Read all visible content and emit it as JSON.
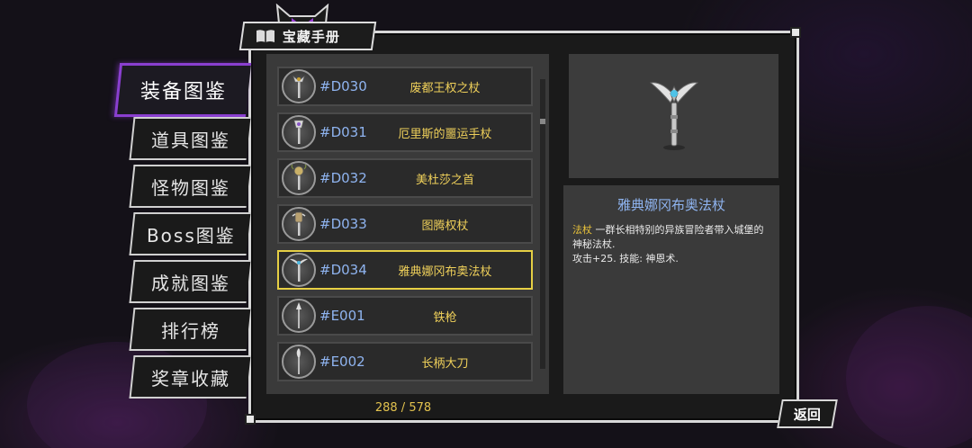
{
  "title": "宝藏手册",
  "categories": [
    {
      "label": "装备图鉴",
      "active": true
    },
    {
      "label": "道具图鉴",
      "active": false
    },
    {
      "label": "怪物图鉴",
      "active": false
    },
    {
      "label": "Boss图鉴",
      "active": false
    },
    {
      "label": "成就图鉴",
      "active": false
    },
    {
      "label": "排行榜",
      "active": false
    },
    {
      "label": "奖章收藏",
      "active": false
    }
  ],
  "items": [
    {
      "code": "#D030",
      "name": "废都王权之杖",
      "icon": "scepter-icon",
      "selected": false
    },
    {
      "code": "#D031",
      "name": "厄里斯的噩运手杖",
      "icon": "staff-icon",
      "selected": false
    },
    {
      "code": "#D032",
      "name": "美杜莎之首",
      "icon": "medusa-staff-icon",
      "selected": false
    },
    {
      "code": "#D033",
      "name": "图腾权杖",
      "icon": "totem-staff-icon",
      "selected": false
    },
    {
      "code": "#D034",
      "name": "雅典娜冈布奥法杖",
      "icon": "winged-staff-icon",
      "selected": true
    },
    {
      "code": "#E001",
      "name": "铁枪",
      "icon": "spear-icon",
      "selected": false
    },
    {
      "code": "#E002",
      "name": "长柄大刀",
      "icon": "glaive-icon",
      "selected": false
    }
  ],
  "page_count": "288 / 578",
  "detail": {
    "name": "雅典娜冈布奥法杖",
    "category_word": "法杖",
    "description": " 一群长相特别的异族冒险者带入城堡的神秘法杖.",
    "stats": "攻击+25. 技能: 神恩术."
  },
  "back_label": "返回",
  "colors": {
    "accent_purple": "#8a3fd0",
    "selected_border": "#e6cf44",
    "item_code": "#8fb4f0",
    "item_name": "#efd05a"
  }
}
